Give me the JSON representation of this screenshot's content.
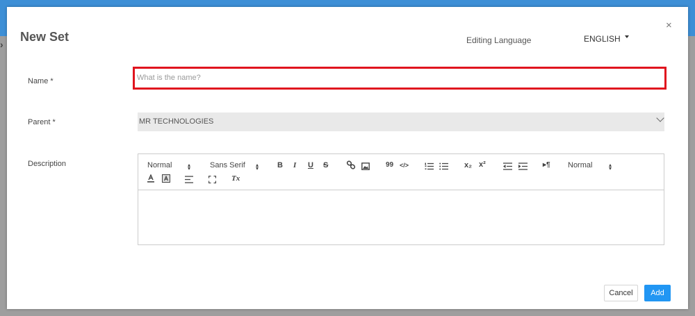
{
  "modal": {
    "title": "New Set",
    "close_glyph": "×",
    "editing_language_label": "Editing Language",
    "language_value": "ENGLISH"
  },
  "form": {
    "name": {
      "label": "Name *",
      "value": "",
      "placeholder": "What is the name?"
    },
    "parent": {
      "label": "Parent *",
      "value": "MR TECHNOLOGIES"
    },
    "description": {
      "label": "Description",
      "toolbar": {
        "header_select": "Normal",
        "font_select": "Sans Serif",
        "size_select": "Normal",
        "bold": "B",
        "italic": "I",
        "underline": "U",
        "strike": "S",
        "quote": "99",
        "code": "</>",
        "subscript": "x₂",
        "superscript": "x²",
        "direction": "▸¶",
        "clean": "Tx"
      },
      "value": ""
    }
  },
  "footer": {
    "cancel_label": "Cancel",
    "add_label": "Add"
  },
  "colors": {
    "accent": "#2196f3",
    "highlight_border": "#e0141e",
    "topbar": "#3d8fd6"
  }
}
